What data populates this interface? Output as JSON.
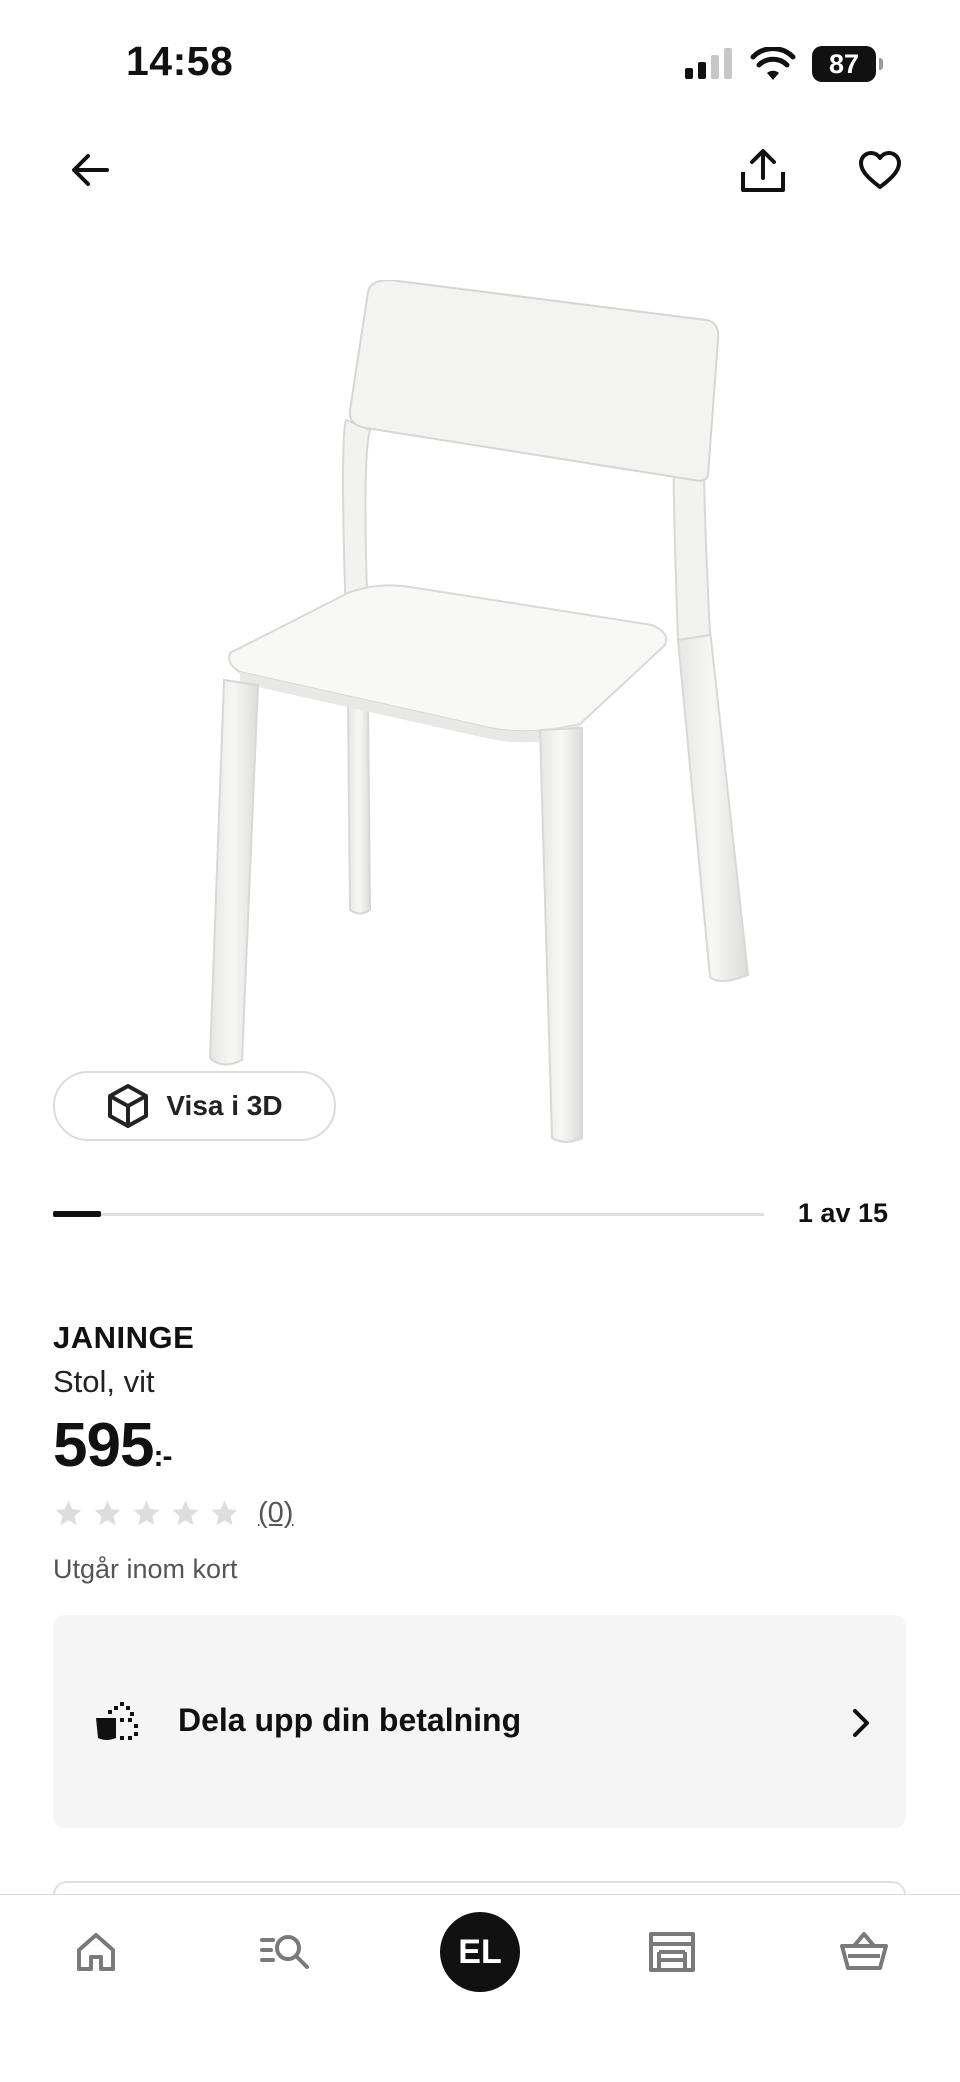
{
  "status_bar": {
    "time": "14:58",
    "battery": "87",
    "icons": [
      "signal-icon",
      "wifi-icon",
      "battery-icon"
    ]
  },
  "top_nav": {
    "icons": [
      "back-arrow-icon",
      "share-icon",
      "heart-icon"
    ]
  },
  "product_image": {
    "icon": "chair-image",
    "view_3d_label": "Visa i 3D",
    "pager": "1 av 15",
    "progress": 0.0667
  },
  "product": {
    "name": "JANINGE",
    "description": "Stol, vit",
    "price": "595",
    "price_suffix": ":-",
    "rating_stars": 0,
    "rating_max": 5,
    "review_count": "(0)",
    "availability": "Utgår inom kort"
  },
  "installment": {
    "label": "Dela upp din betalning",
    "icon": "split-payment-icon"
  },
  "tabbar": {
    "items": [
      "home-icon",
      "search-list-icon",
      "profile-avatar",
      "store-icon",
      "basket-icon"
    ],
    "avatar_initials": "EL"
  },
  "colors": {
    "text": "#111111",
    "muted": "#555555",
    "card_bg": "#f5f5f5",
    "star_empty": "#dddddd"
  }
}
